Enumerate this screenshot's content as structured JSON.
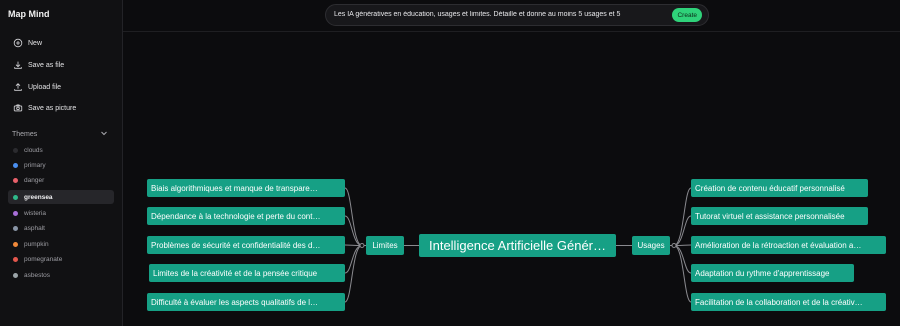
{
  "app": {
    "title": "Map Mind"
  },
  "sidebar": {
    "actions": [
      {
        "label": "New",
        "icon": "plus-circle-icon"
      },
      {
        "label": "Save as file",
        "icon": "download-icon"
      },
      {
        "label": "Upload file",
        "icon": "upload-icon"
      },
      {
        "label": "Save as picture",
        "icon": "camera-icon"
      }
    ],
    "themes_label": "Themes",
    "themes": [
      {
        "label": "clouds",
        "color": "#2b2b2f"
      },
      {
        "label": "primary",
        "color": "#4a8ff0"
      },
      {
        "label": "danger",
        "color": "#e8606a"
      },
      {
        "label": "greensea",
        "color": "#2fb98a",
        "selected": true
      },
      {
        "label": "wisteria",
        "color": "#a86fd8"
      },
      {
        "label": "asphalt",
        "color": "#8995a6"
      },
      {
        "label": "pumpkin",
        "color": "#f0893a"
      },
      {
        "label": "pomegranate",
        "color": "#e4574d"
      },
      {
        "label": "asbestos",
        "color": "#9ba4a8"
      }
    ]
  },
  "prompt": {
    "text": "Les IA génératives en éducation, usages et limites. Détaille et donne au moins 5 usages et 5",
    "create_label": "Create"
  },
  "mindmap": {
    "root": "Intelligence Artificielle Génér…",
    "left_branch": {
      "label": "Limites",
      "children": [
        "Biais algorithmiques et manque de transpare…",
        "Dépendance à la technologie et perte du cont…",
        "Problèmes de sécurité et confidentialité des d…",
        "Limites de la créativité et de la pensée critique",
        "Difficulté à évaluer les aspects qualitatifs de l…"
      ]
    },
    "right_branch": {
      "label": "Usages",
      "children": [
        "Création de contenu éducatif personnalisé",
        "Tutorat virtuel et assistance personnalisée",
        "Amélioration de la rétroaction et évaluation a…",
        "Adaptation du rythme d'apprentissage",
        "Facilitation de la collaboration et de la créativ…"
      ]
    },
    "colors": {
      "node": "#16a085",
      "line": "#8a8a8f"
    }
  }
}
